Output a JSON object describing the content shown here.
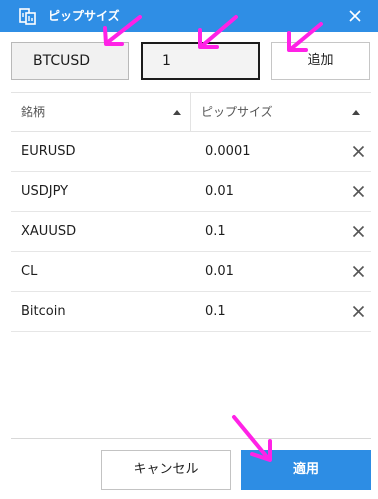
{
  "window": {
    "title": "ピップサイズ",
    "app_icon": "app-icon",
    "close_icon": "close-icon"
  },
  "form": {
    "symbol_value": "BTCUSD",
    "pip_value": "1",
    "add_label": "追加"
  },
  "table": {
    "columns": [
      "銘柄",
      "ピップサイズ"
    ],
    "rows": [
      {
        "symbol": "EURUSD",
        "pip": "0.0001"
      },
      {
        "symbol": "USDJPY",
        "pip": "0.01"
      },
      {
        "symbol": "XAUUSD",
        "pip": "0.1"
      },
      {
        "symbol": "CL",
        "pip": "0.01"
      },
      {
        "symbol": "Bitcoin",
        "pip": "0.1"
      }
    ]
  },
  "footer": {
    "cancel_label": "キャンセル",
    "apply_label": "適用"
  },
  "colors": {
    "accent": "#2f8ee5",
    "annotation_arrow": "#ff22e6"
  }
}
